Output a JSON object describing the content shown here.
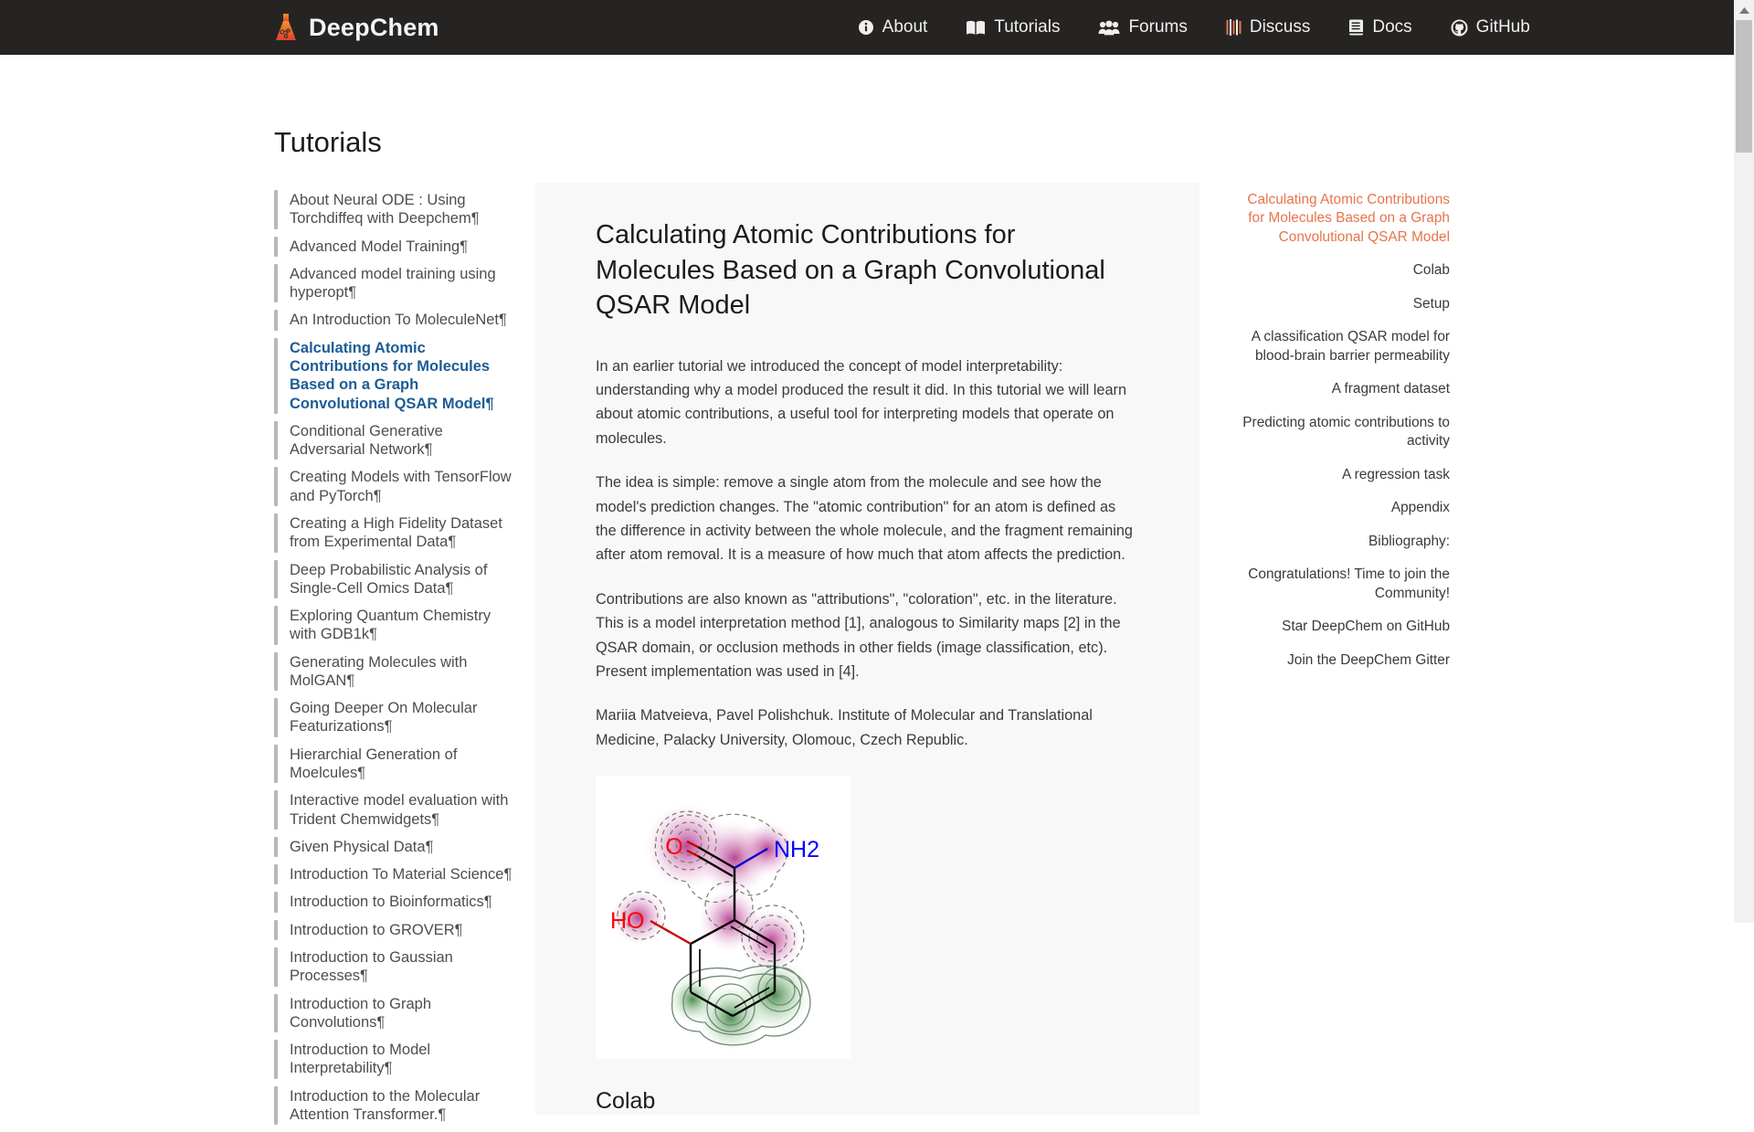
{
  "header": {
    "brand": "DeepChem",
    "brand_icon": "flask-icon",
    "nav": [
      {
        "label": "About",
        "icon": "info-circle-icon"
      },
      {
        "label": "Tutorials",
        "icon": "book-open-icon"
      },
      {
        "label": "Forums",
        "icon": "users-icon"
      },
      {
        "label": "Discuss",
        "icon": "discourse-icon"
      },
      {
        "label": "Docs",
        "icon": "book-icon"
      },
      {
        "label": "GitHub",
        "icon": "github-icon"
      }
    ],
    "background": "#252423"
  },
  "page": {
    "title": "Tutorials"
  },
  "sidebar": {
    "items": [
      {
        "label": "About Neural ODE : Using Torchdiffeq with Deepchem¶",
        "active": false
      },
      {
        "label": "Advanced Model Training¶",
        "active": false
      },
      {
        "label": "Advanced model training using hyperopt¶",
        "active": false
      },
      {
        "label": "An Introduction To MoleculeNet¶",
        "active": false
      },
      {
        "label": "Calculating Atomic Contributions for Molecules Based on a Graph Convolutional QSAR Model¶",
        "active": true
      },
      {
        "label": "Conditional Generative Adversarial Network¶",
        "active": false
      },
      {
        "label": "Creating Models with TensorFlow and PyTorch¶",
        "active": false
      },
      {
        "label": "Creating a High Fidelity Dataset from Experimental Data¶",
        "active": false
      },
      {
        "label": "Deep Probabilistic Analysis of Single-Cell Omics Data¶",
        "active": false
      },
      {
        "label": "Exploring Quantum Chemistry with GDB1k¶",
        "active": false
      },
      {
        "label": "Generating Molecules with MolGAN¶",
        "active": false
      },
      {
        "label": "Going Deeper On Molecular Featurizations¶",
        "active": false
      },
      {
        "label": "Hierarchial Generation of Moelcules¶",
        "active": false
      },
      {
        "label": "Interactive model evaluation with Trident Chemwidgets¶",
        "active": false
      },
      {
        "label": "Given Physical Data¶",
        "active": false
      },
      {
        "label": "Introduction To Material Science¶",
        "active": false
      },
      {
        "label": "Introduction to Bioinformatics¶",
        "active": false
      },
      {
        "label": "Introduction to GROVER¶",
        "active": false
      },
      {
        "label": "Introduction to Gaussian Processes¶",
        "active": false
      },
      {
        "label": "Introduction to Graph Convolutions¶",
        "active": false
      },
      {
        "label": "Introduction to Model Interpretability¶",
        "active": false
      },
      {
        "label": "Introduction to the Molecular Attention Transformer.¶",
        "active": false
      }
    ]
  },
  "article": {
    "title": "Calculating Atomic Contributions for Molecules Based on a Graph Convolutional QSAR Model",
    "paragraphs": [
      "In an earlier tutorial we introduced the concept of model interpretability: understanding why a model produced the result it did. In this tutorial we will learn about atomic contributions, a useful tool for interpreting models that operate on molecules.",
      "The idea is simple: remove a single atom from the molecule and see how the model's prediction changes. The \"atomic contribution\" for an atom is defined as the difference in activity between the whole molecule, and the fragment remaining after atom removal. It is a measure of how much that atom affects the prediction.",
      "Contributions are also known as \"attributions\", \"coloration\", etc. in the literature. This is a model interpretation method [1], analogous to Similarity maps [2] in the QSAR domain, or occlusion methods in other fields (image classification, etc). Present implementation was used in [4].",
      "Mariia Matveieva, Pavel Polishchuk. Institute of Molecular and Translational Medicine, Palacky University, Olomouc, Czech Republic."
    ],
    "figure": {
      "name": "molecule-contribution-map",
      "atom_labels": [
        "O",
        "NH2",
        "HO"
      ],
      "positive_color": "#b0338a",
      "negative_color": "#2f7d32"
    },
    "next_heading": "Colab"
  },
  "toc": {
    "items": [
      {
        "label": "Calculating Atomic Contributions for Molecules Based on a Graph Convolutional QSAR Model",
        "active": true
      },
      {
        "label": "Colab",
        "active": false
      },
      {
        "label": "Setup",
        "active": false
      },
      {
        "label": "A classification QSAR model for blood-brain barrier permeability",
        "active": false
      },
      {
        "label": "A fragment dataset",
        "active": false
      },
      {
        "label": "Predicting atomic contributions to activity",
        "active": false
      },
      {
        "label": "A regression task",
        "active": false
      },
      {
        "label": "Appendix",
        "active": false
      },
      {
        "label": "Bibliography:",
        "active": false
      },
      {
        "label": "Congratulations! Time to join the Community!",
        "active": false
      },
      {
        "label": "Star DeepChem on GitHub",
        "active": false
      },
      {
        "label": "Join the DeepChem Gitter",
        "active": false
      }
    ],
    "active_color": "#e8744b"
  }
}
